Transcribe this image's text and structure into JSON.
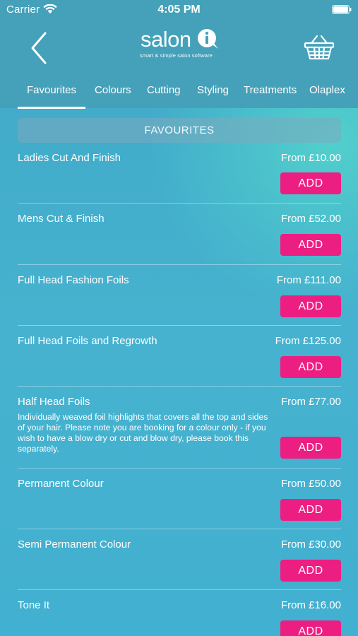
{
  "status_bar": {
    "carrier": "Carrier",
    "time": "4:05 PM"
  },
  "brand": {
    "name": "salon",
    "tagline": "smart & simple salon software"
  },
  "icons": {
    "back": "chevron-left-icon",
    "basket": "shopping-basket-icon",
    "wifi": "wifi-icon",
    "battery": "battery-icon"
  },
  "colors": {
    "header_bg": "#44a1b9",
    "body_bg": "#46b2cf",
    "accent_teal": "#54d6cd",
    "add_button": "#ed1e82"
  },
  "tabs": [
    {
      "label": "Favourites",
      "active": true
    },
    {
      "label": "Colours",
      "active": false
    },
    {
      "label": "Cutting",
      "active": false
    },
    {
      "label": "Styling",
      "active": false
    },
    {
      "label": "Treatments",
      "active": false
    },
    {
      "label": "Olaplex",
      "active": false
    }
  ],
  "section": {
    "title": "FAVOURITES"
  },
  "add_label": "ADD",
  "services": [
    {
      "name": "Ladies Cut And Finish",
      "price": "From £10.00",
      "description": ""
    },
    {
      "name": "Mens Cut & Finish",
      "price": "From £52.00",
      "description": ""
    },
    {
      "name": "Full Head Fashion Foils",
      "price": "From £111.00",
      "description": ""
    },
    {
      "name": "Full Head Foils and Regrowth",
      "price": "From £125.00",
      "description": ""
    },
    {
      "name": "Half Head Foils",
      "price": "From £77.00",
      "description": "Individually weaved foil highlights that covers all the top and sides of your hair. Please note you are booking for a colour only - if you wish to have a blow dry or cut and blow dry, please book this separately."
    },
    {
      "name": "Permanent Colour",
      "price": "From £50.00",
      "description": ""
    },
    {
      "name": "Semi Permanent Colour",
      "price": "From £30.00",
      "description": ""
    },
    {
      "name": "Tone It",
      "price": "From £16.00",
      "description": ""
    }
  ]
}
